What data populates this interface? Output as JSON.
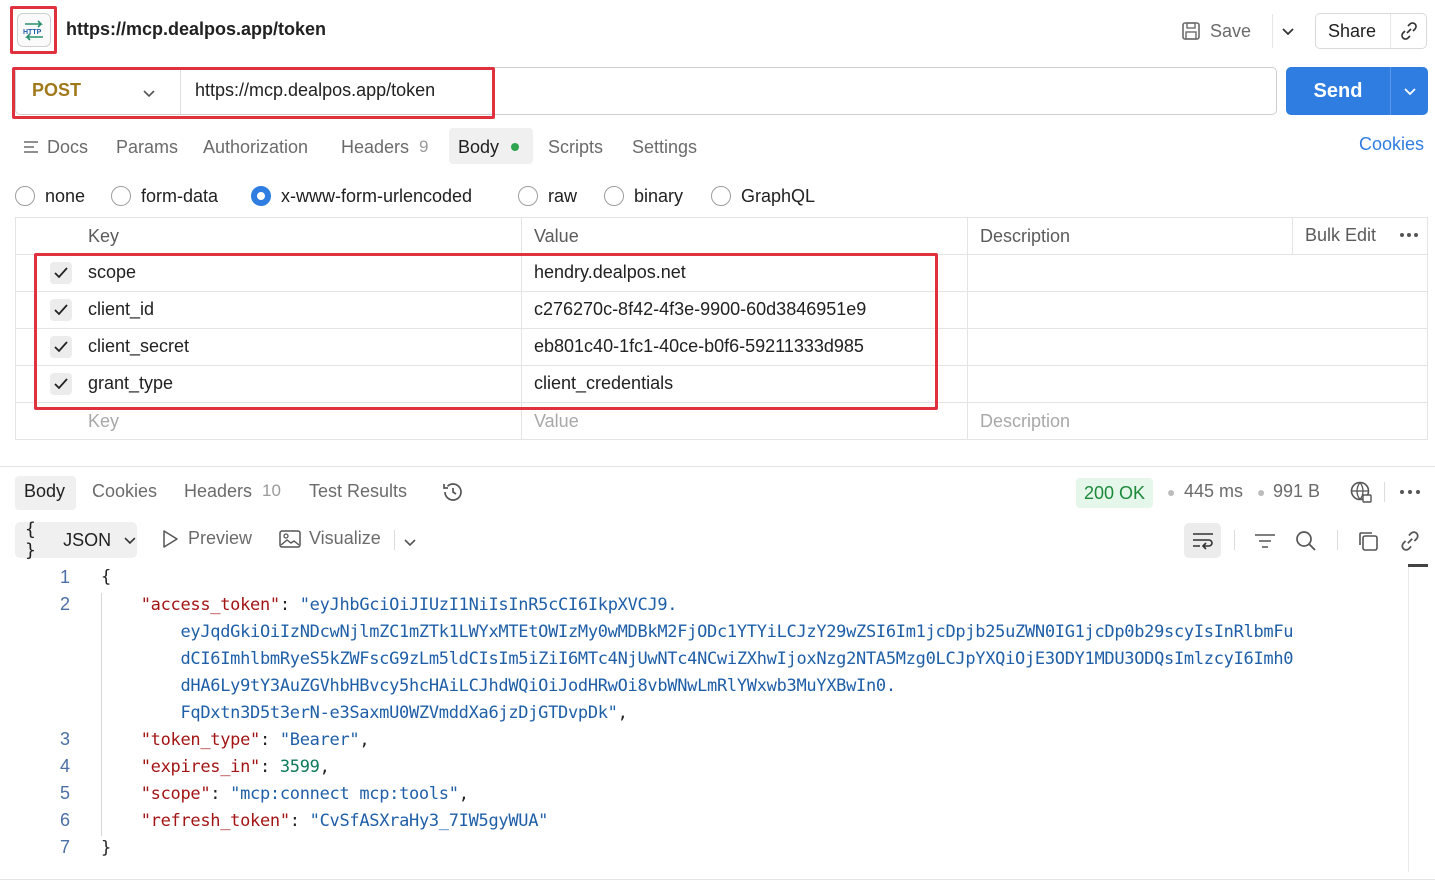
{
  "header": {
    "title": "https://mcp.dealpos.app/token",
    "save_label": "Save",
    "share_label": "Share"
  },
  "request": {
    "method": "POST",
    "url": "https://mcp.dealpos.app/token",
    "send_label": "Send",
    "method_color": "#a0791a"
  },
  "request_tabs": {
    "docs": "Docs",
    "params": "Params",
    "authorization": "Authorization",
    "headers": "Headers",
    "headers_count": "9",
    "body": "Body",
    "scripts": "Scripts",
    "settings": "Settings",
    "cookies": "Cookies"
  },
  "body_types": {
    "none": "none",
    "form_data": "form-data",
    "urlencoded": "x-www-form-urlencoded",
    "raw": "raw",
    "binary": "binary",
    "graphql": "GraphQL",
    "selected": "x-www-form-urlencoded"
  },
  "params_table": {
    "headers": {
      "key": "Key",
      "value": "Value",
      "description": "Description",
      "bulk_edit": "Bulk Edit"
    },
    "rows": [
      {
        "checked": true,
        "key": "scope",
        "value": "hendry.dealpos.net",
        "description": ""
      },
      {
        "checked": true,
        "key": "client_id",
        "value": "c276270c-8f42-4f3e-9900-60d3846951e9",
        "description": ""
      },
      {
        "checked": true,
        "key": "client_secret",
        "value": "eb801c40-1fc1-40ce-b0f6-59211333d985",
        "description": ""
      },
      {
        "checked": true,
        "key": "grant_type",
        "value": "client_credentials",
        "description": ""
      }
    ],
    "placeholders": {
      "key": "Key",
      "value": "Value",
      "description": "Description"
    }
  },
  "response_tabs": {
    "body": "Body",
    "cookies": "Cookies",
    "headers": "Headers",
    "headers_count": "10",
    "test_results": "Test Results"
  },
  "response_meta": {
    "status": "200 OK",
    "time": "445 ms",
    "size": "991 B",
    "status_color": "#1d8a3a"
  },
  "view": {
    "format": "JSON",
    "format_icon": "{ }",
    "preview": "Preview",
    "visualize": "Visualize"
  },
  "response_json": {
    "line_numbers": [
      "1",
      "2",
      "3",
      "4",
      "5",
      "6",
      "7"
    ],
    "open_brace": "{",
    "close_brace": "}",
    "access_token_key": "\"access_token\"",
    "access_token_lines": [
      "\"eyJhbGciOiJIUzI1NiIsInR5cCI6IkpXVCJ9.",
      "eyJqdGkiOiIzNDcwNjlmZC1mZTk1LWYxMTEtOWIzMy0wMDBkM2FjODc1YTYiLCJzY29wZSI6Im1jcDpjb25uZWN0IG1jcDp0b29scyIsInRlbmFu",
      "dCI6ImhlbmRyeS5kZWFscG9zLm5ldCIsIm5iZiI6MTc4NjUwNTc4NCwiZXhwIjoxNzg2NTA5Mzg0LCJpYXQiOjE3ODY1MDU3ODQsImlzcyI6Imh0",
      "dHA6Ly9tY3AuZGVhbHBvcy5hcHAiLCJhdWQiOiJodHRwOi8vbWNwLmRlYWxwb3MuYXBwIn0.",
      "FqDxtn3D5t3erN-e3SaxmU0WZVmddXa6jzDjGTDvpDk\""
    ],
    "token_type_key": "\"token_type\"",
    "token_type_value": "\"Bearer\"",
    "expires_in_key": "\"expires_in\"",
    "expires_in_value": "3599",
    "scope_key": "\"scope\"",
    "scope_value": "\"mcp:connect mcp:tools\"",
    "refresh_token_key": "\"refresh_token\"",
    "refresh_token_value": "\"CvSfASXraHy3_7IW5gyWUA\""
  }
}
